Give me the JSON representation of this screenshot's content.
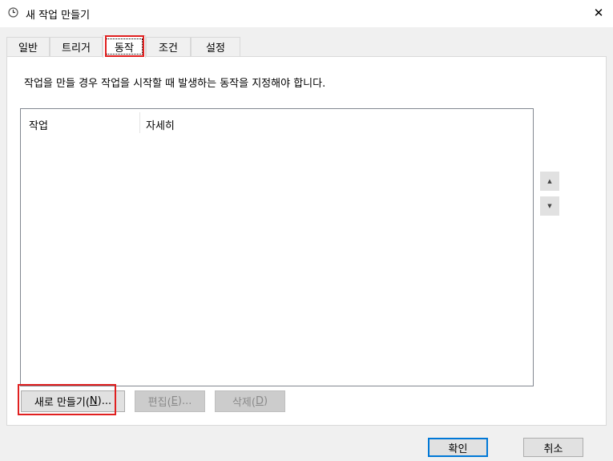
{
  "window": {
    "title": "새 작업 만들기",
    "close_glyph": "✕"
  },
  "tabs": [
    {
      "label": "일반"
    },
    {
      "label": "트리거"
    },
    {
      "label": "동작",
      "selected": true
    },
    {
      "label": "조건"
    },
    {
      "label": "설정"
    }
  ],
  "actions_page": {
    "instruction": "작업을 만들 경우 작업을 시작할 때 발생하는 동작을 지정해야 합니다.",
    "list": {
      "columns": [
        "작업",
        "자세히"
      ],
      "rows": []
    },
    "move_up_glyph": "▲",
    "move_down_glyph": "▼",
    "new_button": {
      "label": "새로 만들기(",
      "mnemonic": "N",
      "suffix": ")..."
    },
    "edit_button": {
      "label": "편집(",
      "mnemonic": "E",
      "suffix": ")..."
    },
    "delete_button": {
      "label": "삭제(",
      "mnemonic": "D",
      "suffix": ")"
    }
  },
  "footer": {
    "ok_label": "확인",
    "cancel_label": "취소"
  },
  "colors": {
    "highlight": "#e02020",
    "default_button_border": "#0078d7",
    "dialog_bg": "#f0f0f0"
  }
}
